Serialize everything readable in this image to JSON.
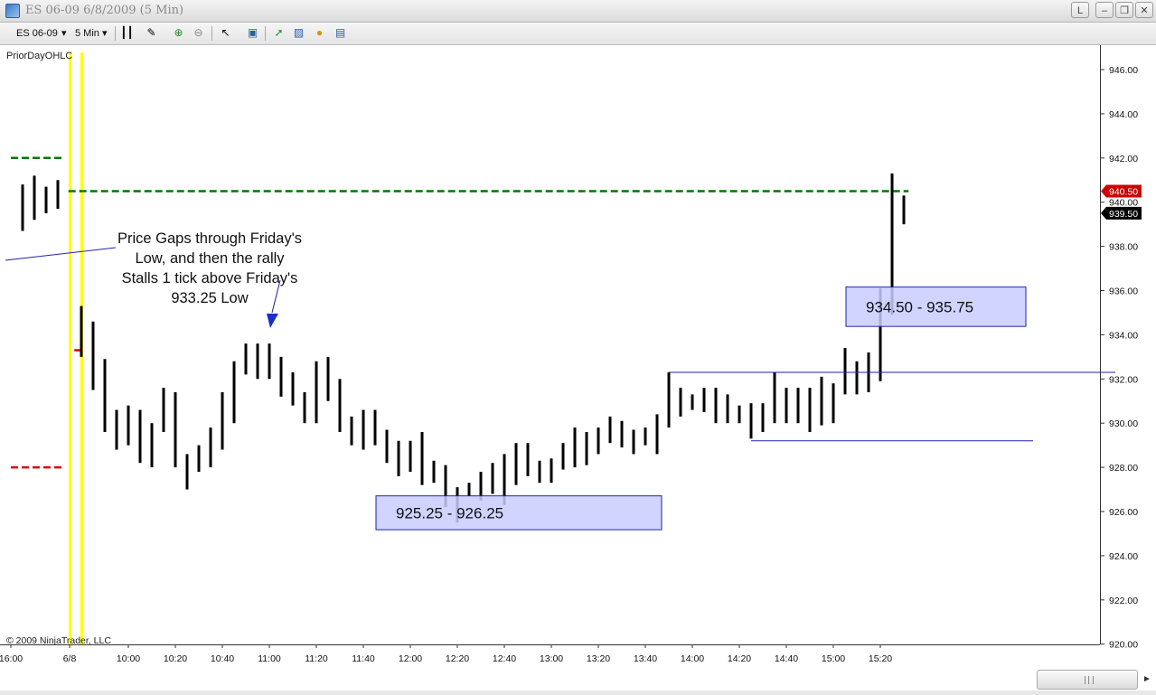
{
  "window": {
    "title": "ES 06-09  6/8/2009 (5 Min)",
    "buttons": [
      "L",
      "–",
      "❐",
      "✕"
    ]
  },
  "toolbar": {
    "instrument": "ES 06-09",
    "interval": "5 Min"
  },
  "indicator_label": "PriorDayOHLC",
  "copyright": "© 2009 NinjaTrader, LLC",
  "colors": {
    "bar": "#000000",
    "session_line": "#ffff00",
    "prior_high": "#007700",
    "prior_low": "#dd0000",
    "annotation_box": "#c8ccff",
    "annotation_line": "#2222aa",
    "price_marker_red": "#cc0000",
    "price_marker_black": "#000000"
  },
  "chart_data": {
    "type": "ohlc",
    "ylim": [
      920,
      947
    ],
    "yticks": [
      "946.00",
      "944.00",
      "942.00",
      "940.00",
      "938.00",
      "936.00",
      "934.00",
      "932.00",
      "930.00",
      "928.00",
      "926.00",
      "924.00",
      "922.00",
      "920.00"
    ],
    "xticks": [
      {
        "label": "16:00",
        "at": -6
      },
      {
        "label": "6/8",
        "at": -1
      },
      {
        "label": "10:00",
        "at": 4
      },
      {
        "label": "10:20",
        "at": 8
      },
      {
        "label": "10:40",
        "at": 12
      },
      {
        "label": "11:00",
        "at": 16
      },
      {
        "label": "11:20",
        "at": 20
      },
      {
        "label": "11:40",
        "at": 24
      },
      {
        "label": "12:00",
        "at": 28
      },
      {
        "label": "12:20",
        "at": 32
      },
      {
        "label": "12:40",
        "at": 36
      },
      {
        "label": "13:00",
        "at": 40
      },
      {
        "label": "13:20",
        "at": 44
      },
      {
        "label": "13:40",
        "at": 48
      },
      {
        "label": "14:00",
        "at": 52
      },
      {
        "label": "14:20",
        "at": 56
      },
      {
        "label": "14:40",
        "at": 60
      },
      {
        "label": "15:00",
        "at": 64
      },
      {
        "label": "15:20",
        "at": 68
      }
    ],
    "prior_bars": [
      {
        "i": -5,
        "h": 940.8,
        "l": 938.7
      },
      {
        "i": -4,
        "h": 941.2,
        "l": 939.2
      },
      {
        "i": -3,
        "h": 940.7,
        "l": 939.5
      },
      {
        "i": -2,
        "h": 941.0,
        "l": 939.7
      }
    ],
    "bars": [
      {
        "i": 0,
        "h": 935.3,
        "l": 933.0
      },
      {
        "i": 1,
        "h": 934.6,
        "l": 931.5
      },
      {
        "i": 2,
        "h": 932.9,
        "l": 929.6
      },
      {
        "i": 3,
        "h": 930.6,
        "l": 928.8
      },
      {
        "i": 4,
        "h": 930.8,
        "l": 929.0
      },
      {
        "i": 5,
        "h": 930.6,
        "l": 928.2
      },
      {
        "i": 6,
        "h": 930.0,
        "l": 928.0
      },
      {
        "i": 7,
        "h": 931.6,
        "l": 929.6
      },
      {
        "i": 8,
        "h": 931.4,
        "l": 928.0
      },
      {
        "i": 9,
        "h": 928.6,
        "l": 927.0
      },
      {
        "i": 10,
        "h": 929.0,
        "l": 927.8
      },
      {
        "i": 11,
        "h": 929.8,
        "l": 928.0
      },
      {
        "i": 12,
        "h": 931.4,
        "l": 928.8
      },
      {
        "i": 13,
        "h": 932.8,
        "l": 930.0
      },
      {
        "i": 14,
        "h": 933.6,
        "l": 932.2
      },
      {
        "i": 15,
        "h": 933.6,
        "l": 932.0
      },
      {
        "i": 16,
        "h": 933.6,
        "l": 932.0
      },
      {
        "i": 17,
        "h": 933.0,
        "l": 931.2
      },
      {
        "i": 18,
        "h": 932.3,
        "l": 930.8
      },
      {
        "i": 19,
        "h": 931.4,
        "l": 930.0
      },
      {
        "i": 20,
        "h": 932.8,
        "l": 930.0
      },
      {
        "i": 21,
        "h": 933.0,
        "l": 931.0
      },
      {
        "i": 22,
        "h": 932.0,
        "l": 929.6
      },
      {
        "i": 23,
        "h": 930.3,
        "l": 929.0
      },
      {
        "i": 24,
        "h": 930.6,
        "l": 928.8
      },
      {
        "i": 25,
        "h": 930.6,
        "l": 929.0
      },
      {
        "i": 26,
        "h": 929.7,
        "l": 928.2
      },
      {
        "i": 27,
        "h": 929.2,
        "l": 927.6
      },
      {
        "i": 28,
        "h": 929.2,
        "l": 927.8
      },
      {
        "i": 29,
        "h": 929.6,
        "l": 927.2
      },
      {
        "i": 30,
        "h": 928.3,
        "l": 927.3
      },
      {
        "i": 31,
        "h": 928.1,
        "l": 926.2
      },
      {
        "i": 32,
        "h": 927.1,
        "l": 925.5
      },
      {
        "i": 33,
        "h": 927.3,
        "l": 926.7
      },
      {
        "i": 34,
        "h": 927.8,
        "l": 926.5
      },
      {
        "i": 35,
        "h": 928.2,
        "l": 926.8
      },
      {
        "i": 36,
        "h": 928.6,
        "l": 926.3
      },
      {
        "i": 37,
        "h": 929.1,
        "l": 927.2
      },
      {
        "i": 38,
        "h": 929.1,
        "l": 927.6
      },
      {
        "i": 39,
        "h": 928.3,
        "l": 927.3
      },
      {
        "i": 40,
        "h": 928.4,
        "l": 927.3
      },
      {
        "i": 41,
        "h": 929.1,
        "l": 927.9
      },
      {
        "i": 42,
        "h": 929.8,
        "l": 928.0
      },
      {
        "i": 43,
        "h": 929.6,
        "l": 928.1
      },
      {
        "i": 44,
        "h": 929.8,
        "l": 928.6
      },
      {
        "i": 45,
        "h": 930.3,
        "l": 929.1
      },
      {
        "i": 46,
        "h": 930.1,
        "l": 928.9
      },
      {
        "i": 47,
        "h": 929.7,
        "l": 928.6
      },
      {
        "i": 48,
        "h": 929.8,
        "l": 929.0
      },
      {
        "i": 49,
        "h": 930.4,
        "l": 928.6
      },
      {
        "i": 50,
        "h": 932.3,
        "l": 929.8
      },
      {
        "i": 51,
        "h": 931.6,
        "l": 930.3
      },
      {
        "i": 52,
        "h": 931.3,
        "l": 930.6
      },
      {
        "i": 53,
        "h": 931.6,
        "l": 930.5
      },
      {
        "i": 54,
        "h": 931.6,
        "l": 930.0
      },
      {
        "i": 55,
        "h": 931.3,
        "l": 930.0
      },
      {
        "i": 56,
        "h": 930.8,
        "l": 930.0
      },
      {
        "i": 57,
        "h": 930.9,
        "l": 929.3
      },
      {
        "i": 58,
        "h": 930.9,
        "l": 929.6
      },
      {
        "i": 59,
        "h": 932.3,
        "l": 930.0
      },
      {
        "i": 60,
        "h": 931.6,
        "l": 930.0
      },
      {
        "i": 61,
        "h": 931.6,
        "l": 930.0
      },
      {
        "i": 62,
        "h": 931.6,
        "l": 929.6
      },
      {
        "i": 63,
        "h": 932.1,
        "l": 929.9
      },
      {
        "i": 64,
        "h": 931.8,
        "l": 930.0
      },
      {
        "i": 65,
        "h": 933.4,
        "l": 931.3
      },
      {
        "i": 66,
        "h": 932.8,
        "l": 931.3
      },
      {
        "i": 67,
        "h": 933.2,
        "l": 931.4
      },
      {
        "i": 68,
        "h": 936.1,
        "l": 931.9
      },
      {
        "i": 69,
        "h": 941.3,
        "l": 934.9
      },
      {
        "i": 70,
        "h": 940.3,
        "l": 939.0
      }
    ],
    "prior_day_levels": [
      {
        "name": "high",
        "y": 942.0,
        "from": -6,
        "to": -1.5
      },
      {
        "name": "low",
        "y": 928.0,
        "from": -6,
        "to": -1.5
      },
      {
        "name": "open_tick",
        "y": 933.3,
        "from": -0.6,
        "to": 0
      }
    ],
    "reference_line": {
      "y": 940.5,
      "from": -1.1,
      "to": 70.4
    },
    "session_breaks": [
      -1,
      0
    ],
    "price_markers": [
      {
        "label": "940.50",
        "y": 940.5,
        "style": "red"
      },
      {
        "label": "939.50",
        "y": 939.5,
        "style": "black"
      }
    ],
    "annotations": {
      "gap_text": [
        "Price Gaps through Friday's",
        "Low, and then the rally",
        "Stalls 1 tick above Friday's",
        "933.25 Low"
      ],
      "boxes": [
        {
          "label": "925.25 - 926.25",
          "x0": 25,
          "x1": 49,
          "y0": 925.3,
          "y1": 926.3
        },
        {
          "label": "934.50 - 935.75",
          "x0": 65,
          "x1": 80,
          "y0": 934.5,
          "y1": 935.75
        }
      ],
      "support_lines": [
        {
          "y": 932.3,
          "from": 50,
          "to": 88
        },
        {
          "y": 929.2,
          "from": 57,
          "to": 81
        }
      ]
    }
  }
}
